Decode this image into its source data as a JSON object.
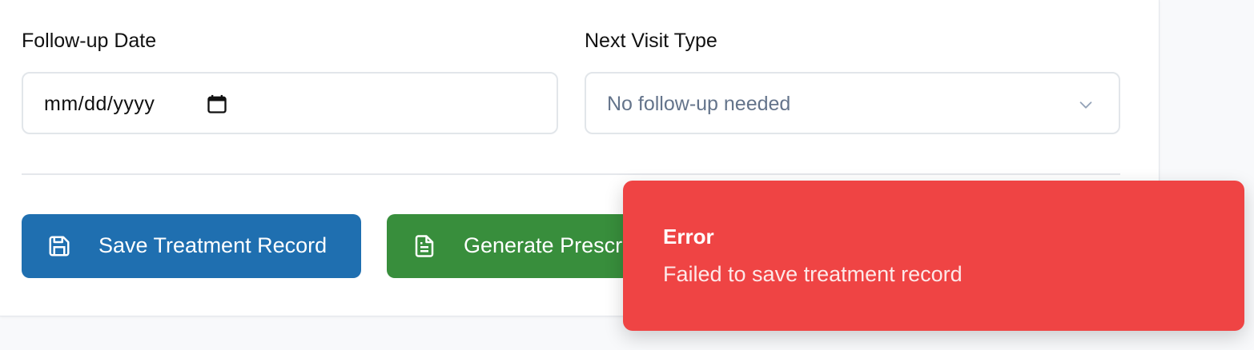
{
  "followup_date": {
    "label": "Follow-up Date",
    "value": "mm/dd/yyyy",
    "icon": "calendar-icon"
  },
  "next_visit_type": {
    "label": "Next Visit Type",
    "selected": "No follow-up needed",
    "icon": "chevron-down-icon"
  },
  "actions": {
    "save_label": "Save Treatment Record",
    "save_icon": "save-icon",
    "save_color": "#1f6fb0",
    "generate_label": "Generate Prescription",
    "generate_icon": "document-icon",
    "generate_color": "#388e3c"
  },
  "toast": {
    "title": "Error",
    "message": "Failed to save treatment record",
    "color": "#ef4444"
  }
}
